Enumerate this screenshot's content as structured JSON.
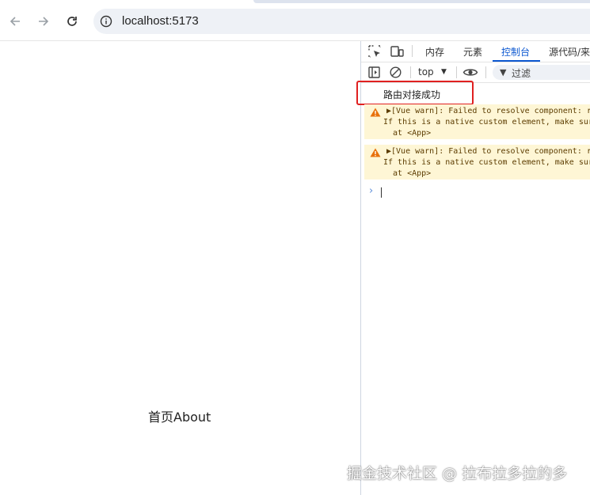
{
  "browser": {
    "url": "localhost:5173",
    "icons": {
      "back": "arrow-left-icon",
      "forward": "arrow-right-icon",
      "reload": "reload-icon",
      "site_info": "info-icon"
    }
  },
  "page": {
    "links_text": "首页About"
  },
  "devtools": {
    "tabs": [
      {
        "label": "内存"
      },
      {
        "label": "元素"
      },
      {
        "label": "控制台",
        "active": true
      },
      {
        "label": "源代码/来"
      }
    ],
    "toolbar": {
      "context": "top",
      "filter_label": "过滤"
    },
    "console": {
      "log_message": "路由对接成功",
      "warnings": [
        {
          "line1": "▶[Vue warn]: Failed to resolve component: r",
          "line2": "If this is a native custom element, make sure",
          "line3": "  at <App>"
        },
        {
          "line1": "▶[Vue warn]: Failed to resolve component: r",
          "line2": "If this is a native custom element, make sure",
          "line3": "  at <App>"
        }
      ]
    },
    "accent_color": "#0b57d0",
    "warning_bg": "#fef6d5",
    "highlight_color": "#e02020"
  },
  "watermark": "掘金技术社区 @ 拉布拉多拉的多"
}
